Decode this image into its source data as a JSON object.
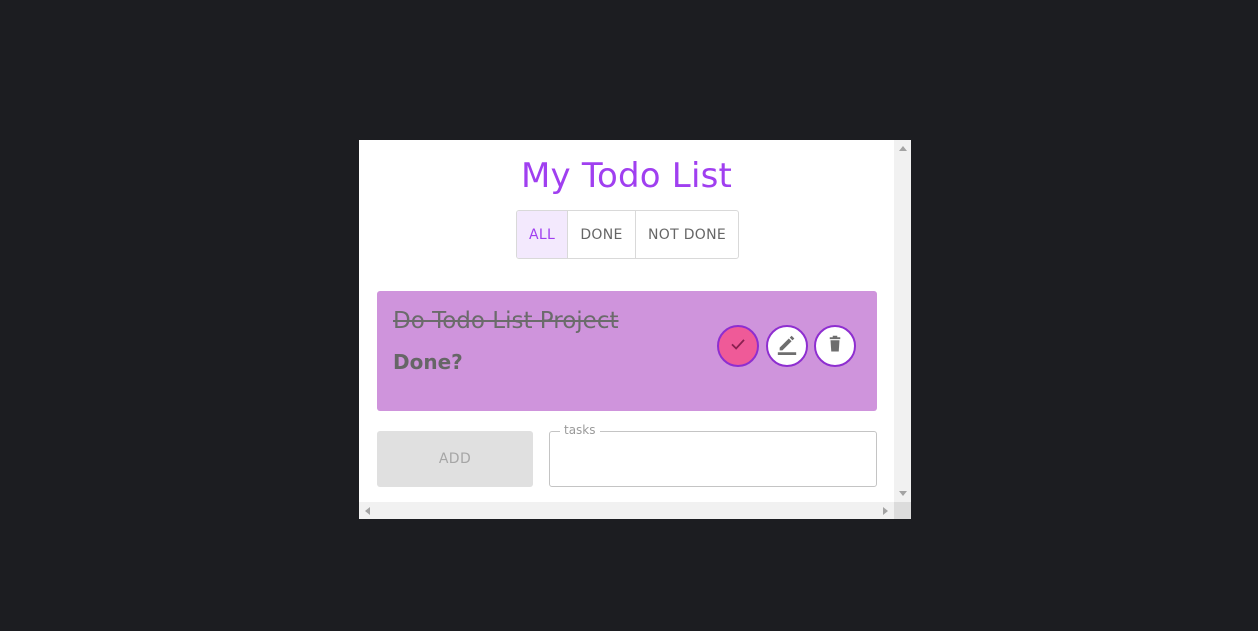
{
  "app": {
    "title": "My Todo List",
    "accent_color": "#a03ff0"
  },
  "filters": {
    "items": [
      "ALL",
      "DONE",
      "NOT DONE"
    ],
    "active": "ALL"
  },
  "todos": [
    {
      "text": "Do Todo List Project",
      "status_label": "Done?",
      "completed": true,
      "card_color": "#cf94dc",
      "actions": [
        {
          "icon": "check-icon",
          "color": "#ef5a98"
        },
        {
          "icon": "pencil-icon",
          "color": "#ffffff"
        },
        {
          "icon": "trash-icon",
          "color": "#ffffff"
        }
      ]
    }
  ],
  "add_form": {
    "add_label": "ADD",
    "field_label": "tasks",
    "field_value": ""
  }
}
